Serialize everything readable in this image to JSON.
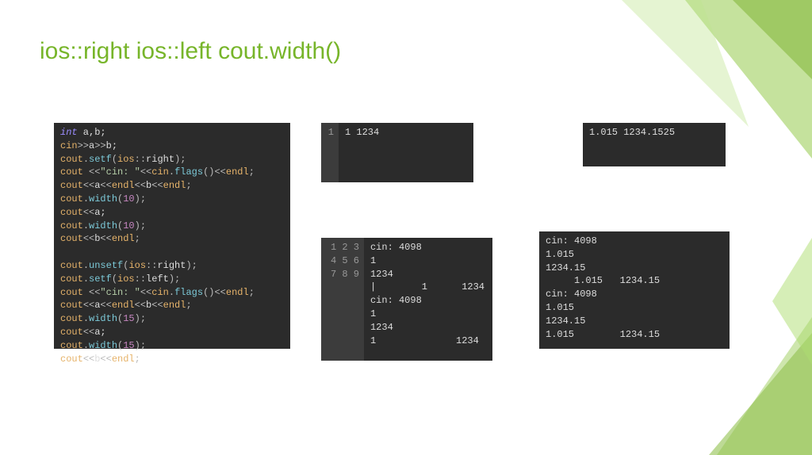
{
  "title": "ios::right ios::left cout.width()",
  "main_code": {
    "lines": [
      [
        {
          "c": "kw",
          "t": "int"
        },
        {
          "c": "plain",
          "t": " a,b;"
        }
      ],
      [
        {
          "c": "id",
          "t": "cin"
        },
        {
          "c": "op",
          "t": ">>"
        },
        {
          "c": "plain",
          "t": "a"
        },
        {
          "c": "op",
          "t": ">>"
        },
        {
          "c": "plain",
          "t": "b;"
        }
      ],
      [
        {
          "c": "id",
          "t": "cout"
        },
        {
          "c": "op",
          "t": "."
        },
        {
          "c": "fn",
          "t": "setf"
        },
        {
          "c": "op",
          "t": "("
        },
        {
          "c": "id",
          "t": "ios"
        },
        {
          "c": "op",
          "t": "::"
        },
        {
          "c": "plain",
          "t": "right"
        },
        {
          "c": "op",
          "t": ");"
        }
      ],
      [
        {
          "c": "id",
          "t": "cout"
        },
        {
          "c": "op",
          "t": " <<"
        },
        {
          "c": "str",
          "t": "\"cin: \""
        },
        {
          "c": "op",
          "t": "<<"
        },
        {
          "c": "id",
          "t": "cin"
        },
        {
          "c": "op",
          "t": "."
        },
        {
          "c": "fn",
          "t": "flags"
        },
        {
          "c": "op",
          "t": "()"
        },
        {
          "c": "op",
          "t": "<<"
        },
        {
          "c": "id",
          "t": "endl"
        },
        {
          "c": "op",
          "t": ";"
        }
      ],
      [
        {
          "c": "id",
          "t": "cout"
        },
        {
          "c": "op",
          "t": "<<"
        },
        {
          "c": "plain",
          "t": "a"
        },
        {
          "c": "op",
          "t": "<<"
        },
        {
          "c": "id",
          "t": "endl"
        },
        {
          "c": "op",
          "t": "<<"
        },
        {
          "c": "plain",
          "t": "b"
        },
        {
          "c": "op",
          "t": "<<"
        },
        {
          "c": "id",
          "t": "endl"
        },
        {
          "c": "op",
          "t": ";"
        }
      ],
      [
        {
          "c": "id",
          "t": "cout"
        },
        {
          "c": "op",
          "t": "."
        },
        {
          "c": "fn",
          "t": "width"
        },
        {
          "c": "op",
          "t": "("
        },
        {
          "c": "num",
          "t": "10"
        },
        {
          "c": "op",
          "t": ");"
        }
      ],
      [
        {
          "c": "id",
          "t": "cout"
        },
        {
          "c": "op",
          "t": "<<"
        },
        {
          "c": "plain",
          "t": "a;"
        }
      ],
      [
        {
          "c": "id",
          "t": "cout"
        },
        {
          "c": "op",
          "t": "."
        },
        {
          "c": "fn",
          "t": "width"
        },
        {
          "c": "op",
          "t": "("
        },
        {
          "c": "num",
          "t": "10"
        },
        {
          "c": "op",
          "t": ");"
        }
      ],
      [
        {
          "c": "id",
          "t": "cout"
        },
        {
          "c": "op",
          "t": "<<"
        },
        {
          "c": "plain",
          "t": "b"
        },
        {
          "c": "op",
          "t": "<<"
        },
        {
          "c": "id",
          "t": "endl"
        },
        {
          "c": "op",
          "t": ";"
        }
      ],
      [
        {
          "c": "plain",
          "t": " "
        }
      ],
      [
        {
          "c": "id",
          "t": "cout"
        },
        {
          "c": "op",
          "t": "."
        },
        {
          "c": "fn",
          "t": "unsetf"
        },
        {
          "c": "op",
          "t": "("
        },
        {
          "c": "id",
          "t": "ios"
        },
        {
          "c": "op",
          "t": "::"
        },
        {
          "c": "plain",
          "t": "right"
        },
        {
          "c": "op",
          "t": ");"
        }
      ],
      [
        {
          "c": "id",
          "t": "cout"
        },
        {
          "c": "op",
          "t": "."
        },
        {
          "c": "fn",
          "t": "setf"
        },
        {
          "c": "op",
          "t": "("
        },
        {
          "c": "id",
          "t": "ios"
        },
        {
          "c": "op",
          "t": "::"
        },
        {
          "c": "plain",
          "t": "left"
        },
        {
          "c": "op",
          "t": ");"
        }
      ],
      [
        {
          "c": "id",
          "t": "cout"
        },
        {
          "c": "op",
          "t": " <<"
        },
        {
          "c": "str",
          "t": "\"cin: \""
        },
        {
          "c": "op",
          "t": "<<"
        },
        {
          "c": "id",
          "t": "cin"
        },
        {
          "c": "op",
          "t": "."
        },
        {
          "c": "fn",
          "t": "flags"
        },
        {
          "c": "op",
          "t": "()"
        },
        {
          "c": "op",
          "t": "<<"
        },
        {
          "c": "id",
          "t": "endl"
        },
        {
          "c": "op",
          "t": ";"
        }
      ],
      [
        {
          "c": "id",
          "t": "cout"
        },
        {
          "c": "op",
          "t": "<<"
        },
        {
          "c": "plain",
          "t": "a"
        },
        {
          "c": "op",
          "t": "<<"
        },
        {
          "c": "id",
          "t": "endl"
        },
        {
          "c": "op",
          "t": "<<"
        },
        {
          "c": "plain",
          "t": "b"
        },
        {
          "c": "op",
          "t": "<<"
        },
        {
          "c": "id",
          "t": "endl"
        },
        {
          "c": "op",
          "t": ";"
        }
      ],
      [
        {
          "c": "id",
          "t": "cout"
        },
        {
          "c": "op",
          "t": "."
        },
        {
          "c": "fn",
          "t": "width"
        },
        {
          "c": "op",
          "t": "("
        },
        {
          "c": "num",
          "t": "15"
        },
        {
          "c": "op",
          "t": ");"
        }
      ],
      [
        {
          "c": "id",
          "t": "cout"
        },
        {
          "c": "op",
          "t": "<<"
        },
        {
          "c": "plain",
          "t": "a;"
        }
      ],
      [
        {
          "c": "id",
          "t": "cout"
        },
        {
          "c": "op",
          "t": "."
        },
        {
          "c": "fn",
          "t": "width"
        },
        {
          "c": "op",
          "t": "("
        },
        {
          "c": "num",
          "t": "15"
        },
        {
          "c": "op",
          "t": ");"
        }
      ],
      [
        {
          "c": "id",
          "t": "cout"
        },
        {
          "c": "op",
          "t": "<<"
        },
        {
          "c": "plain",
          "t": "b"
        },
        {
          "c": "op",
          "t": "<<"
        },
        {
          "c": "id",
          "t": "endl"
        },
        {
          "c": "op",
          "t": ";"
        }
      ]
    ]
  },
  "out_a": {
    "gutter": [
      "1"
    ],
    "lines": [
      "1 1234"
    ]
  },
  "out_b": {
    "lines": [
      "1.015 1234.1525"
    ]
  },
  "out_c": {
    "gutter": [
      "1",
      "2",
      "3",
      "4",
      "5",
      "6",
      "7",
      "8",
      "9"
    ],
    "lines": [
      "cin: 4098",
      "1",
      "1234",
      "|        1      1234",
      "cin: 4098",
      "1",
      "1234",
      "1              1234",
      " "
    ]
  },
  "out_d": {
    "lines": [
      "cin: 4098",
      "1.015",
      "1234.15",
      "     1.015   1234.15",
      "cin: 4098",
      "1.015",
      "1234.15",
      "1.015        1234.15"
    ]
  }
}
